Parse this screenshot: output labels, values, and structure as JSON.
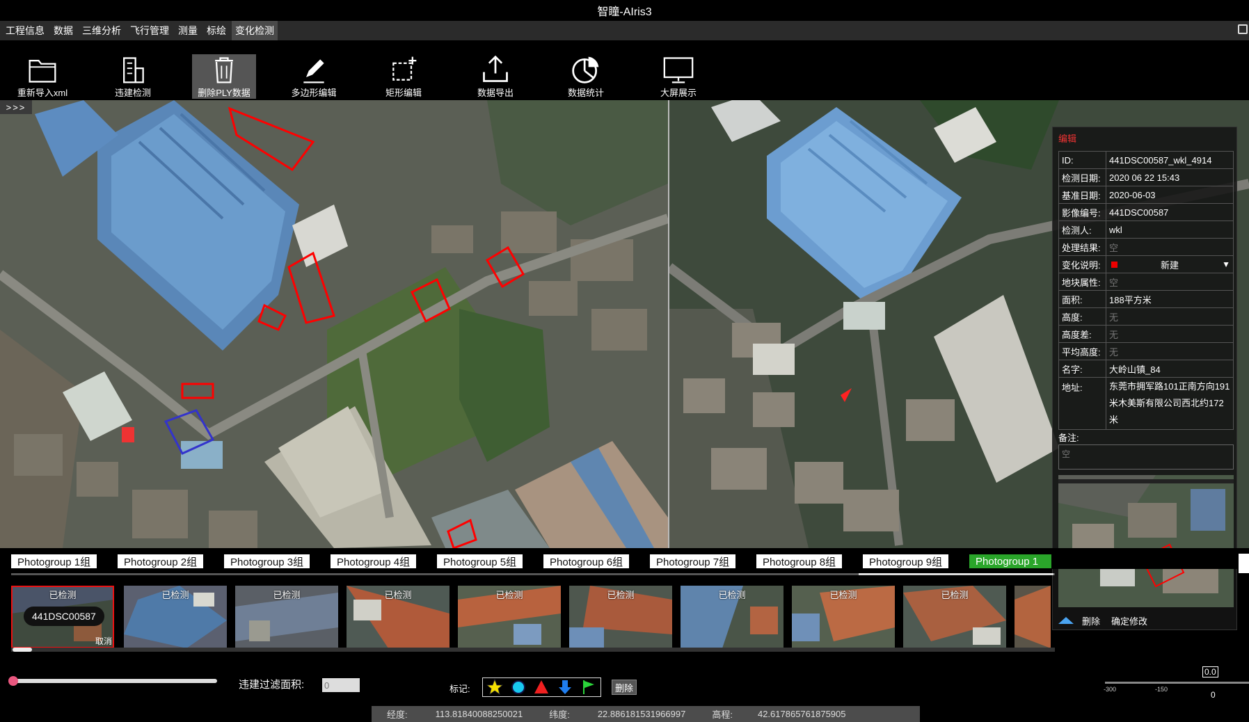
{
  "app": {
    "title": "智瞳-AIris3"
  },
  "menu": [
    "工程信息",
    "数据",
    "三维分析",
    "飞行管理",
    "测量",
    "标绘",
    "变化检测"
  ],
  "menu_active": "变化检测",
  "toolbar": [
    {
      "label": "重新导入xml",
      "icon": "folder-icon"
    },
    {
      "label": "违建检测",
      "icon": "building-icon"
    },
    {
      "label": "删除PLY数据",
      "icon": "trash-icon"
    },
    {
      "label": "多边形编辑",
      "icon": "pencil-icon"
    },
    {
      "label": "矩形编辑",
      "icon": "rectangle-add-icon"
    },
    {
      "label": "数据导出",
      "icon": "export-icon"
    },
    {
      "label": "数据统计",
      "icon": "pie-chart-icon"
    },
    {
      "label": "大屏展示",
      "icon": "monitor-icon"
    }
  ],
  "expand": ">>>",
  "panel": {
    "title": "编辑",
    "fields": {
      "id": {
        "label": "ID:",
        "value": "441DSC00587_wkl_4914"
      },
      "detect_date": {
        "label": "检测日期:",
        "value": "2020 06 22 15:43"
      },
      "base_date": {
        "label": "基准日期:",
        "value": "2020-06-03"
      },
      "image_no": {
        "label": "影像编号:",
        "value": "441DSC00587"
      },
      "inspector": {
        "label": "检测人:",
        "value": "wkl"
      },
      "result": {
        "label": "处理结果:",
        "value": "空"
      },
      "change": {
        "label": "变化说明:",
        "value": "新建"
      },
      "land": {
        "label": "地块属性:",
        "value": "空"
      },
      "area": {
        "label": "面积:",
        "value": "188平方米"
      },
      "height": {
        "label": "高度:",
        "value": "无"
      },
      "height_diff": {
        "label": "高度差:",
        "value": "无"
      },
      "avg_height": {
        "label": "平均高度:",
        "value": "无"
      },
      "name": {
        "label": "名字:",
        "value": "大岭山镇_84"
      },
      "address": {
        "label": "地址:",
        "value": "东莞市拥军路101正南方向191米木美斯有限公司西北约172米"
      }
    },
    "note_label": "备注:",
    "note_value": "空",
    "delete_label": "删除",
    "confirm_label": "确定修改",
    "change_color": "#ee0000"
  },
  "photogroups": [
    "Photogroup 1组",
    "Photogroup 2组",
    "Photogroup 3组",
    "Photogroup 4组",
    "Photogroup 5组",
    "Photogroup 6组",
    "Photogroup 7组",
    "Photogroup 8组",
    "Photogroup 9组",
    "Photogroup 1"
  ],
  "photogroup_active_index": 9,
  "thumbnails": {
    "tag": "已检测",
    "selected_id": "441DSC00587",
    "cancel": "取消",
    "count": 11
  },
  "filter": {
    "label": "违建过滤面积:",
    "value": "0"
  },
  "marks": {
    "label": "标记:",
    "delete": "删除",
    "icons": [
      "star-icon",
      "circle-icon",
      "triangle-icon",
      "arrow-down-icon",
      "flag-icon"
    ]
  },
  "elevation": {
    "value": "0.0",
    "ticks": [
      "-300",
      "-150",
      "0"
    ]
  },
  "status": {
    "lon_label": "经度:",
    "lon": "113.81840088250021",
    "lat_label": "纬度:",
    "lat": "22.886181531966997",
    "alt_label": "高程:",
    "alt": "42.617865761875905"
  }
}
